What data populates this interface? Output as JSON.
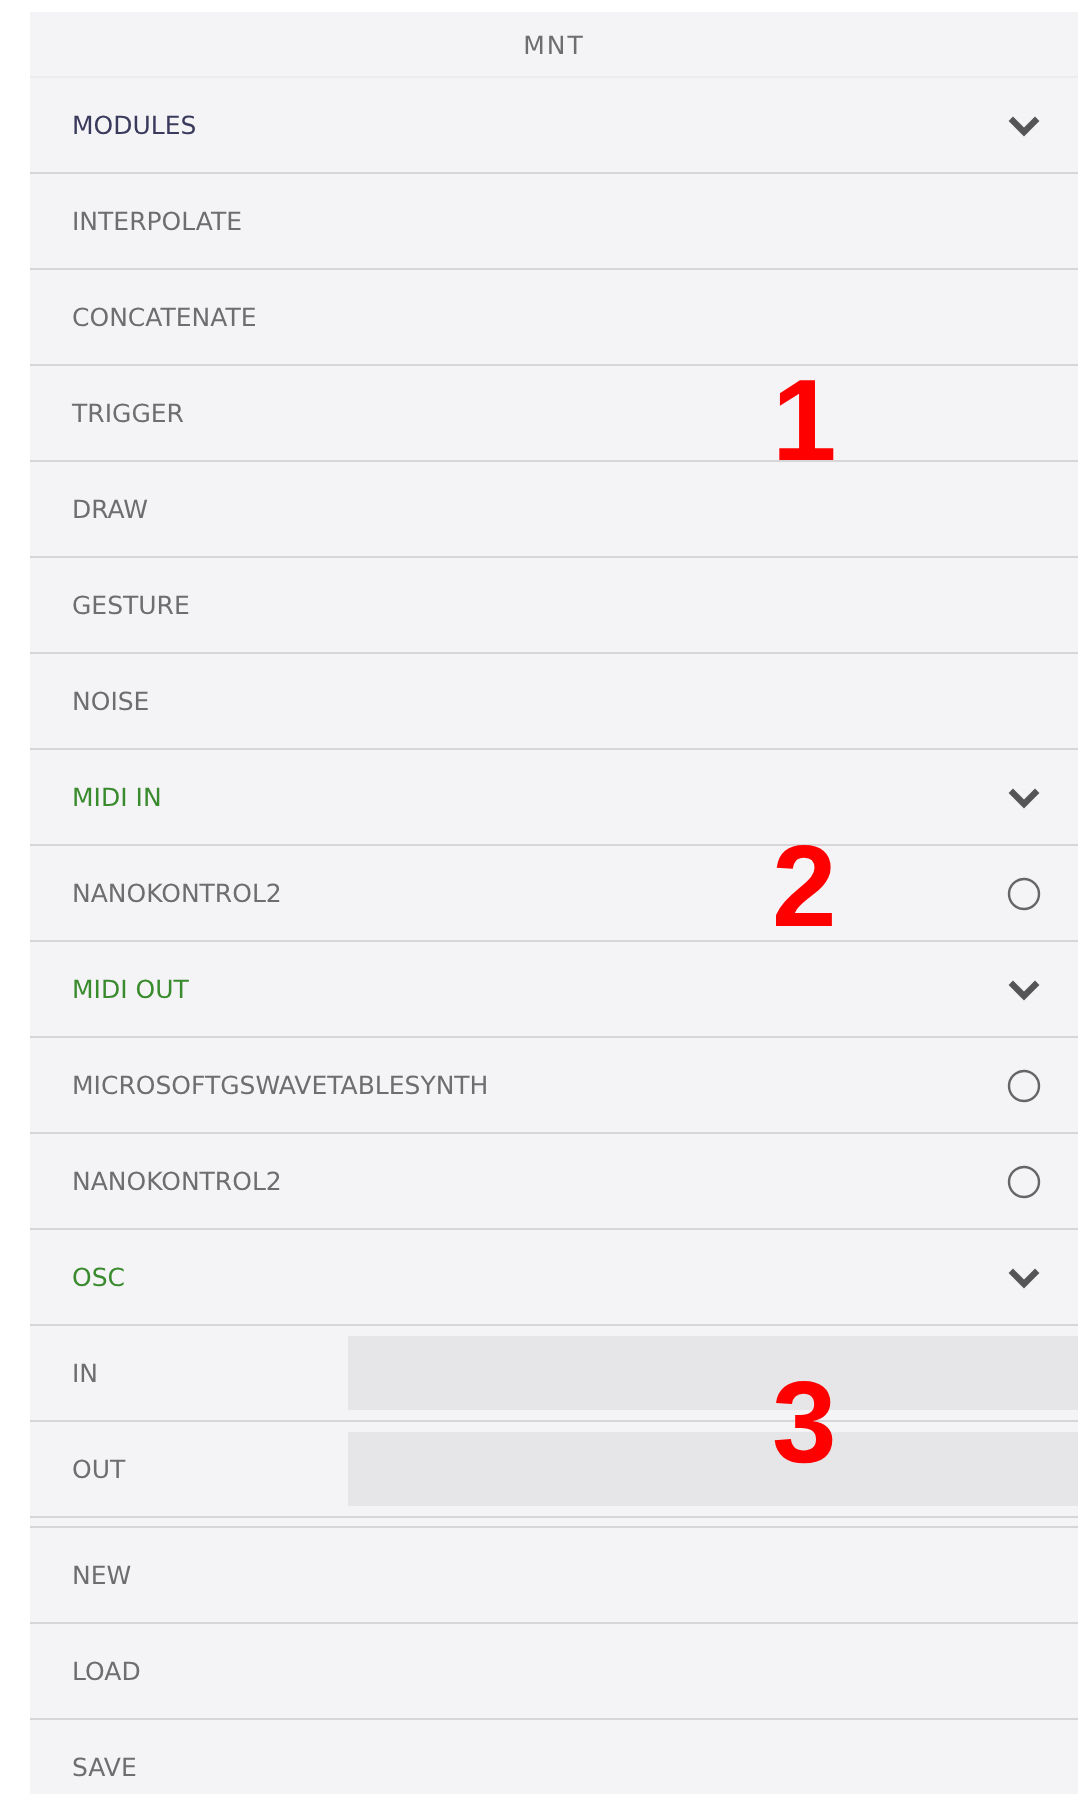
{
  "title": "MNT",
  "sections": [
    {
      "title": "MODULES",
      "color": "#3a3a5c",
      "expanded": true,
      "items": [
        {
          "kind": "plain",
          "label": "INTERPOLATE"
        },
        {
          "kind": "plain",
          "label": "CONCATENATE"
        },
        {
          "kind": "plain",
          "label": "TRIGGER"
        },
        {
          "kind": "plain",
          "label": "DRAW"
        },
        {
          "kind": "plain",
          "label": "GESTURE"
        },
        {
          "kind": "plain",
          "label": "NOISE"
        }
      ]
    },
    {
      "title": "MIDI IN",
      "color": "#3a8a2e",
      "expanded": true,
      "items": [
        {
          "kind": "device",
          "label": "NANOKONTROL2",
          "selected": false
        }
      ]
    },
    {
      "title": "MIDI OUT",
      "color": "#3a8a2e",
      "expanded": true,
      "items": [
        {
          "kind": "device",
          "label": "MICROSOFTGSWAVETABLESYNTH",
          "selected": false
        },
        {
          "kind": "device",
          "label": "NANOKONTROL2",
          "selected": false
        }
      ]
    },
    {
      "title": "OSC",
      "color": "#3a8a2e",
      "expanded": true,
      "items": [
        {
          "kind": "field",
          "label": "IN"
        },
        {
          "kind": "field",
          "label": "OUT"
        }
      ]
    }
  ],
  "actions": [
    "NEW",
    "LOAD",
    "SAVE"
  ],
  "annotations": [
    "1",
    "2",
    "3"
  ]
}
